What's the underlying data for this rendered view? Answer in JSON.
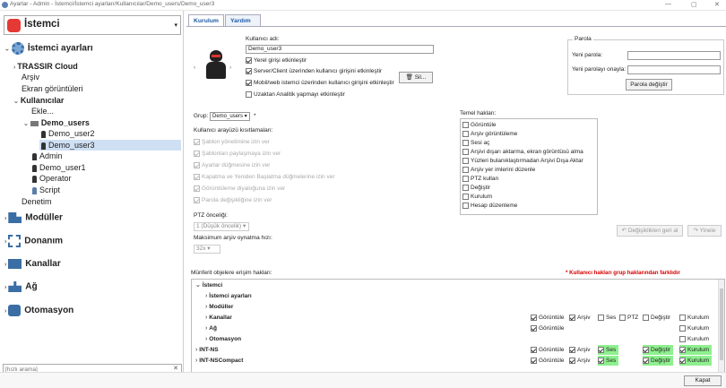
{
  "window": {
    "title": "Ayarlar - Admin - İstemci/İstemci ayarları/Kullanıcılar/Demo_users/Demo_user3",
    "min": "—",
    "max": "▢",
    "close": "✕"
  },
  "sidebar": {
    "header": "İstemci",
    "items": {
      "istemci_ayarlari": "İstemci ayarları",
      "trassir_cloud": "TRASSIR Cloud",
      "arsiv": "Arşiv",
      "ekran": "Ekran görüntüleri",
      "kullanicilar": "Kullanıcılar",
      "ekle": "Ekle...",
      "demo_users": "Demo_users",
      "demo_user2": "Demo_user2",
      "demo_user3": "Demo_user3",
      "admin": "Admin",
      "demo_user1": "Demo_user1",
      "operator": "Operator",
      "script": "Script",
      "denetim": "Denetim",
      "moduller": "Modüller",
      "donanim": "Donanım",
      "kanallar": "Kanallar",
      "ag": "Ağ",
      "otomasyon": "Otomasyon"
    },
    "search_placeholder": "[hızlı arama]"
  },
  "tabs": {
    "kurulum": "Kurulum",
    "yardim": "Yardım"
  },
  "user": {
    "username_label": "Kullanıcı adı:",
    "username_value": "Demo_user3",
    "opt_local": "Yerel girişi etkinleştir",
    "opt_server": "Server/Client üzerinden kullanıcı girişini etkinleştir",
    "opt_mobile": "Mobil/web istemci üzerinden kullanıcı girişini etkinleştir",
    "opt_analytics": "Uzaktan Analitik yapmayı etkinleştir",
    "delete_label": "Sil..."
  },
  "password": {
    "group_title": "Parola",
    "new_label": "Yeni parola:",
    "confirm_label": "Yeni parolayı onayla:",
    "change_button": "Parola değiştir"
  },
  "group": {
    "label": "Grup:",
    "value": "Demo_users",
    "asterisk": "*"
  },
  "interface_limits": {
    "title": "Kullanıcı arayüzü kısıtlamaları:",
    "items": [
      "Şablon yönetimine izin ver",
      "Şablonları paylaşmaya izin ver",
      "Ayarlar düğmesine izin ver",
      "Kapatma ve Yeniden Başlatma düğmelerine izin ver",
      "Görüntüleme diyaloğuna izin ver",
      "Parola değişikliğine izin ver"
    ]
  },
  "ptz": {
    "label": "PTZ önceliği:",
    "value": "1 (Düşük öncelik)"
  },
  "archive_speed": {
    "label": "Maksimum arşiv oynatma hızı:",
    "value": "32x"
  },
  "basic_rights": {
    "title": "Temel hakları:",
    "items": [
      "Görüntüle",
      "Arşiv görüntüleme",
      "Sesi aç",
      "Arşivi dışarı aktarma, ekran görüntüsü alma",
      "Yüzleri bulanıklaştırmadan Arşivi Dışa Aktar",
      "Arşiv yer imlerini düzenle",
      "PTZ kullan",
      "Değiştir",
      "Kurulum",
      "Hesap düzenleme"
    ]
  },
  "actions": {
    "revert": "Değişiklikleri geri al",
    "reload": "Yinele"
  },
  "object_rights": {
    "title": "Münferit objelere erişim hakları:",
    "warning": "* Kullanıcı hakları grup haklarından farklıdır",
    "rows": [
      {
        "name": "İstemci"
      },
      {
        "name": "İstemci ayarları"
      },
      {
        "name": "Modüller"
      },
      {
        "name": "Kanallar"
      },
      {
        "name": "Ağ"
      },
      {
        "name": "Otomasyon"
      },
      {
        "name": "INT-NS"
      },
      {
        "name": "INT-NSCompact"
      }
    ],
    "col_labels": {
      "goruntule": "Görüntüle",
      "arsiv": "Arşiv",
      "ses": "Ses",
      "ptz": "PTZ",
      "degistir": "Değiştir",
      "kurulum": "Kurulum"
    }
  },
  "footer": {
    "close": "Kapat"
  },
  "colors": {
    "accent": "#1d5aa6",
    "highlight": "#8ef08e",
    "warning": "#d40000",
    "logo": "#e53935"
  }
}
